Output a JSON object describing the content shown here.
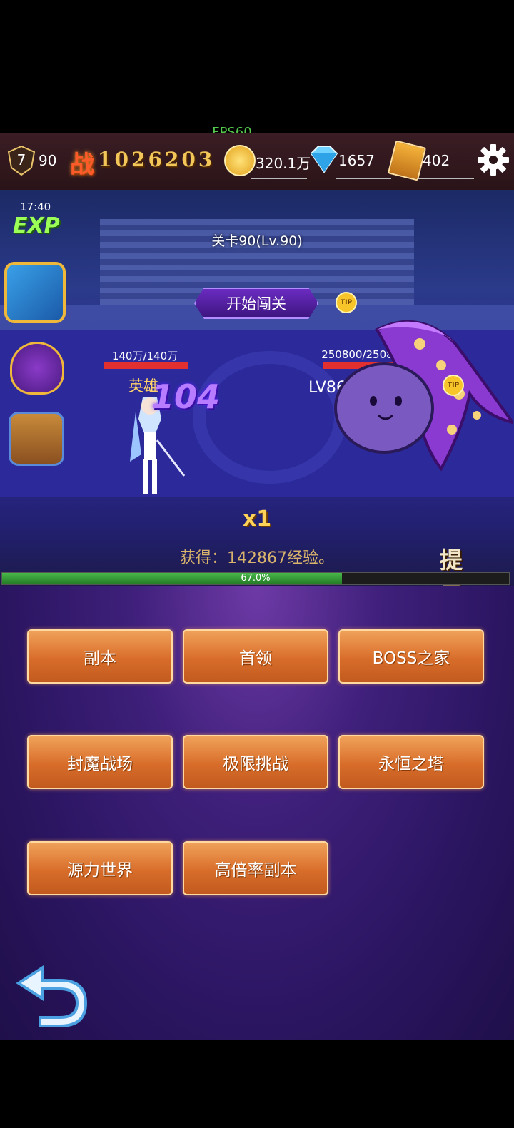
{
  "status": {
    "fps": "FPS60"
  },
  "topbar": {
    "level": "7",
    "level_value": "90",
    "power_label": "战",
    "power": "1026203",
    "gold": "320.1万",
    "diamonds": "1657",
    "tickets": "402"
  },
  "scene": {
    "exp_timer": "17:40",
    "exp_label": "EXP",
    "stage_title": "关卡90(Lv.90)",
    "start_button": "开始闯关",
    "tip_label": "TIP",
    "hero": {
      "hp": "140万/140万",
      "hp_fraction": 1.0,
      "name": "英雄"
    },
    "damage_number": "104",
    "enemy": {
      "hp": "250800/250800",
      "hp_fraction": 1.0,
      "name": "LV86 暗"
    },
    "speed": "x1",
    "log": "获得：142867经验。",
    "hint": "提示",
    "progress": {
      "text": "67.0%",
      "fraction": 0.67
    }
  },
  "menu": {
    "buttons": [
      "副本",
      "首领",
      "BOSS之家",
      "封魔战场",
      "极限挑战",
      "永恒之塔",
      "源力世界",
      "高倍率副本"
    ]
  },
  "colors": {
    "accent_orange": "#e0793a",
    "hp_red": "#e23030",
    "progress_green": "#3aa83c",
    "panel_purple": "#2a1560"
  }
}
